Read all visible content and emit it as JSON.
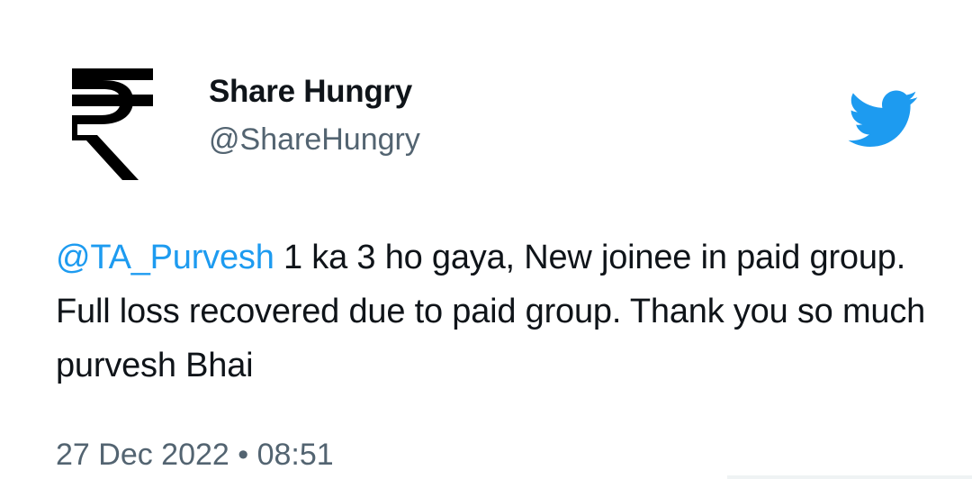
{
  "author": {
    "name": "Share Hungry",
    "handle": "@ShareHungry",
    "avatar_icon": "rupee-symbol-icon"
  },
  "brand": {
    "logo_icon": "twitter-bird-icon",
    "color": "#1d9bf0"
  },
  "tweet": {
    "mention": "@TA_Purvesh",
    "text": " 1 ka 3 ho gaya, New joinee in paid group. Full loss recovered due to paid group. Thank you so much purvesh Bhai",
    "date": "27 Dec 2022",
    "separator": " • ",
    "time": "08:51"
  },
  "colors": {
    "text": "#0f1419",
    "secondary": "#536471",
    "link": "#1d9bf0"
  }
}
